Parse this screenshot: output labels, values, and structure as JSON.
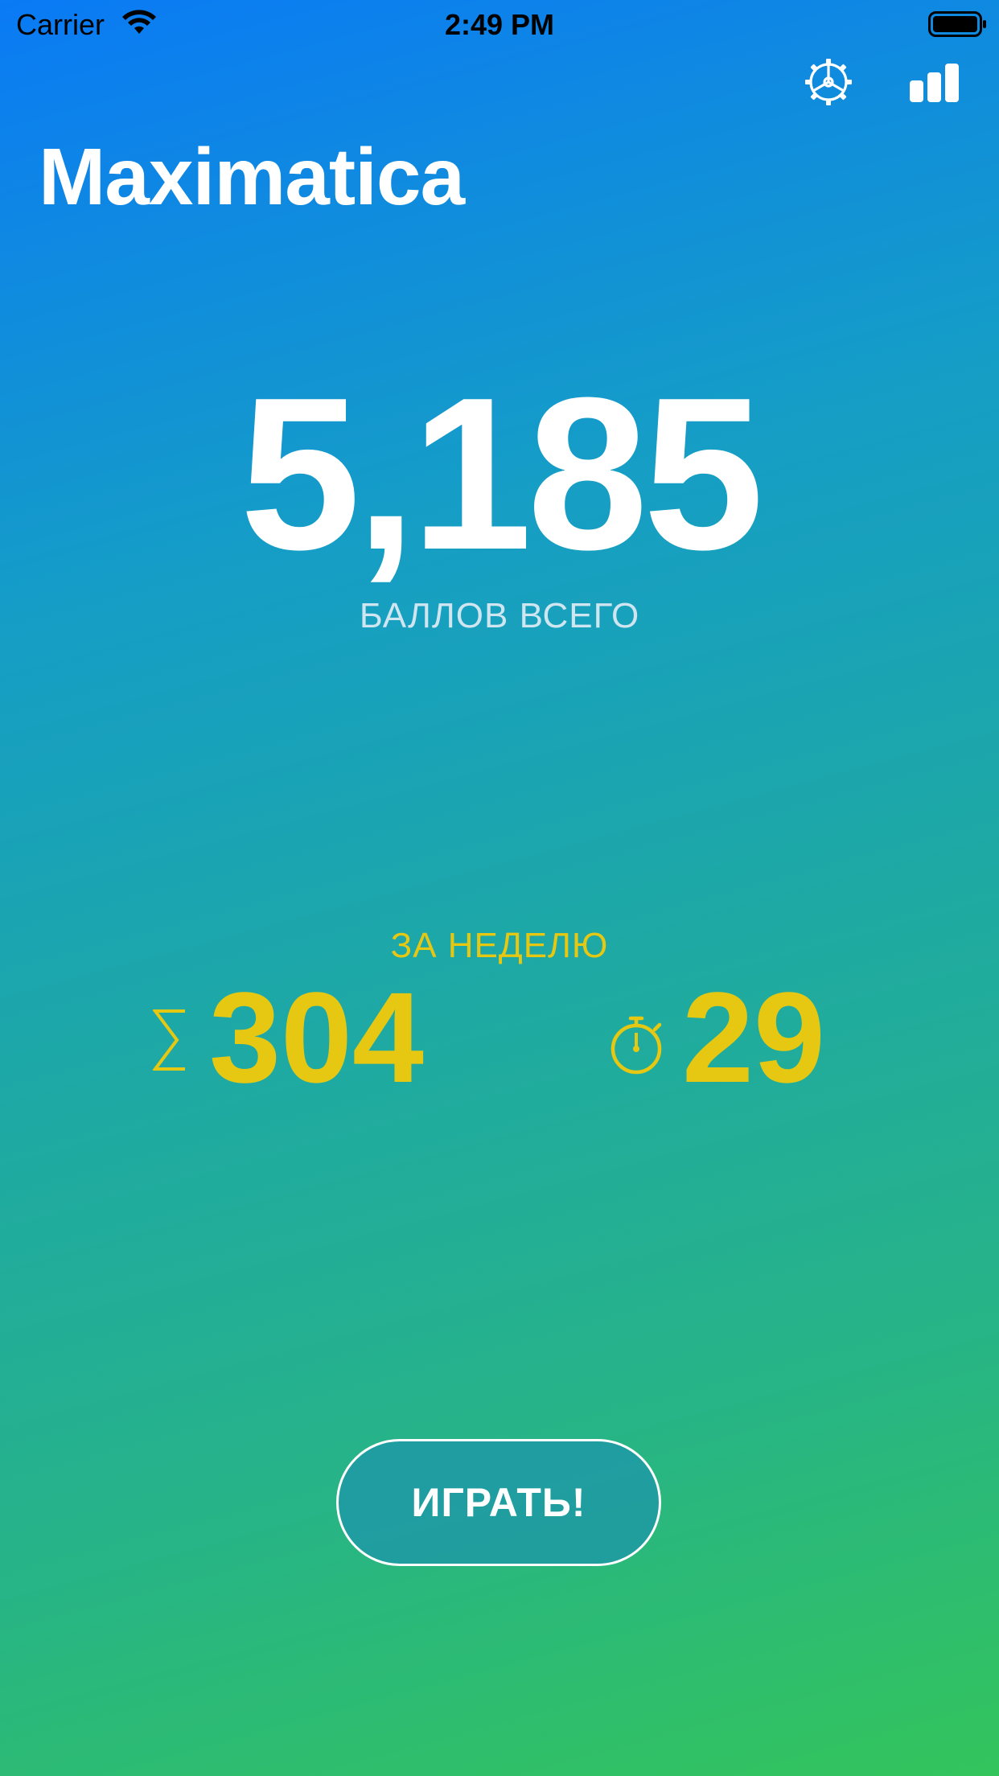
{
  "status_bar": {
    "carrier": "Carrier",
    "time": "2:49 PM",
    "icons": [
      "wifi-icon",
      "battery-icon"
    ]
  },
  "toolbar": {
    "icons": [
      "settings-gear-icon",
      "stats-bars-icon"
    ]
  },
  "app": {
    "title": "Maximatica"
  },
  "total": {
    "score": "5,185",
    "label": "БАЛЛОВ ВСЕГО"
  },
  "week": {
    "label": "ЗА НЕДЕЛЮ",
    "sum_icon": "sigma-icon",
    "sum_value": "304",
    "time_icon": "stopwatch-icon",
    "time_value": "29"
  },
  "play_button": {
    "label": "ИГРАТЬ!"
  },
  "colors": {
    "gradient_top": "#0a7af5",
    "gradient_bottom": "#33c45c",
    "accent_yellow": "#e6c812",
    "text_white": "#ffffff"
  }
}
